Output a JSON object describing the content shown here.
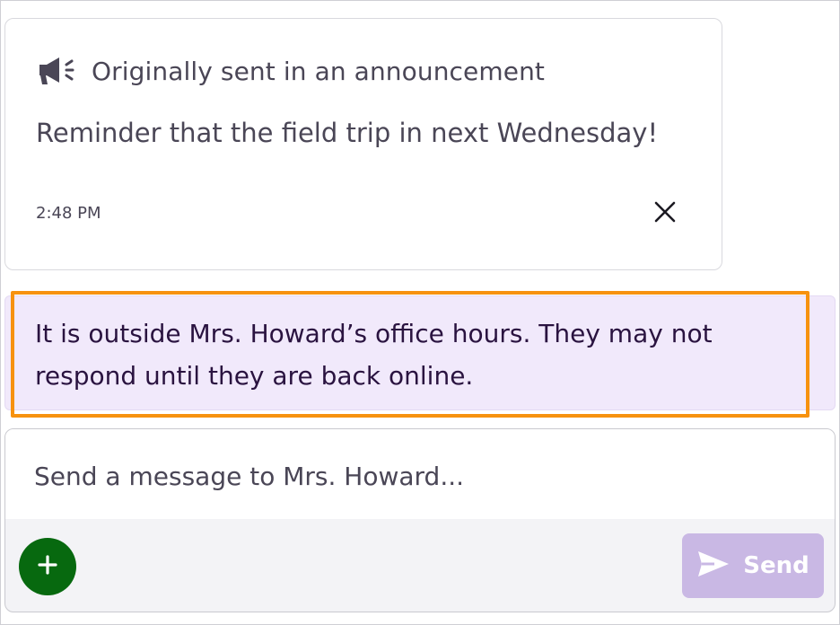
{
  "announcement": {
    "icon": "megaphone-icon",
    "title": "Originally sent in an announcement",
    "body": "Reminder that the field trip in next Wednesday!",
    "time": "2:48 PM",
    "close_icon": "close-icon"
  },
  "notice": {
    "text": "It is outside Mrs. Howard’s office hours. They may not respond until they are back online.",
    "highlight_color": "#f7920f",
    "background_color": "#f1e9fb"
  },
  "composer": {
    "placeholder": "Send a message to Mrs. Howard...",
    "value": "",
    "add_icon": "plus-icon",
    "add_button_color": "#07690f",
    "send_icon": "send-icon",
    "send_label": "Send",
    "send_button_color": "#c9b8e4"
  }
}
